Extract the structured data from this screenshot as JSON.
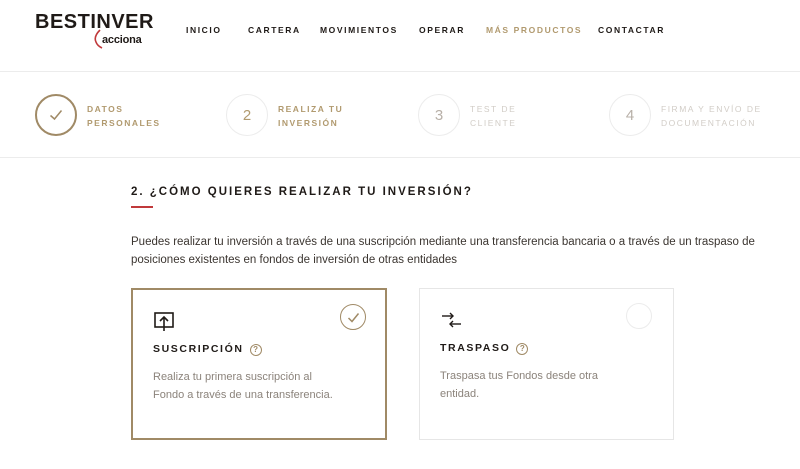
{
  "brand": {
    "name": "BESTINVER",
    "sub": "acciona"
  },
  "nav": [
    {
      "label": "INICIO",
      "active": false
    },
    {
      "label": "CARTERA",
      "active": false
    },
    {
      "label": "MOVIMIENTOS",
      "active": false
    },
    {
      "label": "OPERAR",
      "active": false
    },
    {
      "label": "MÁS PRODUCTOS",
      "active": true
    },
    {
      "label": "CONTACTAR",
      "active": false
    }
  ],
  "steps": [
    {
      "number": "✓",
      "line1": "DATOS",
      "line2": "PERSONALES",
      "state": "done"
    },
    {
      "number": "2",
      "line1": "REALIZA TU",
      "line2": "INVERSIÓN",
      "state": "current"
    },
    {
      "number": "3",
      "line1": "TEST DE",
      "line2": "CLIENTE",
      "state": "pending"
    },
    {
      "number": "4",
      "line1": "FIRMA Y ENVÍO DE",
      "line2": "DOCUMENTACIÓN",
      "state": "pending"
    }
  ],
  "section": {
    "title": "2. ¿CÓMO QUIERES REALIZAR TU INVERSIÓN?",
    "description": "Puedes realizar tu inversión a través de una suscripción mediante una transferencia bancaria o a través de un traspaso de posiciones existentes en fondos de inversión de otras entidades"
  },
  "options": [
    {
      "title": "SUSCRIPCIÓN",
      "help": "?",
      "description": "Realiza tu primera suscripción al Fondo a través de una transferencia.",
      "selected": true,
      "icon": "upload-screen-icon"
    },
    {
      "title": "TRASPASO",
      "help": "?",
      "description": "Traspasa tus Fondos desde otra entidad.",
      "selected": false,
      "icon": "transfer-arrows-icon"
    }
  ],
  "colors": {
    "gold": "#a08a66",
    "accent_red": "#c0393b",
    "text": "#1f1a17",
    "muted": "#8b837b"
  }
}
